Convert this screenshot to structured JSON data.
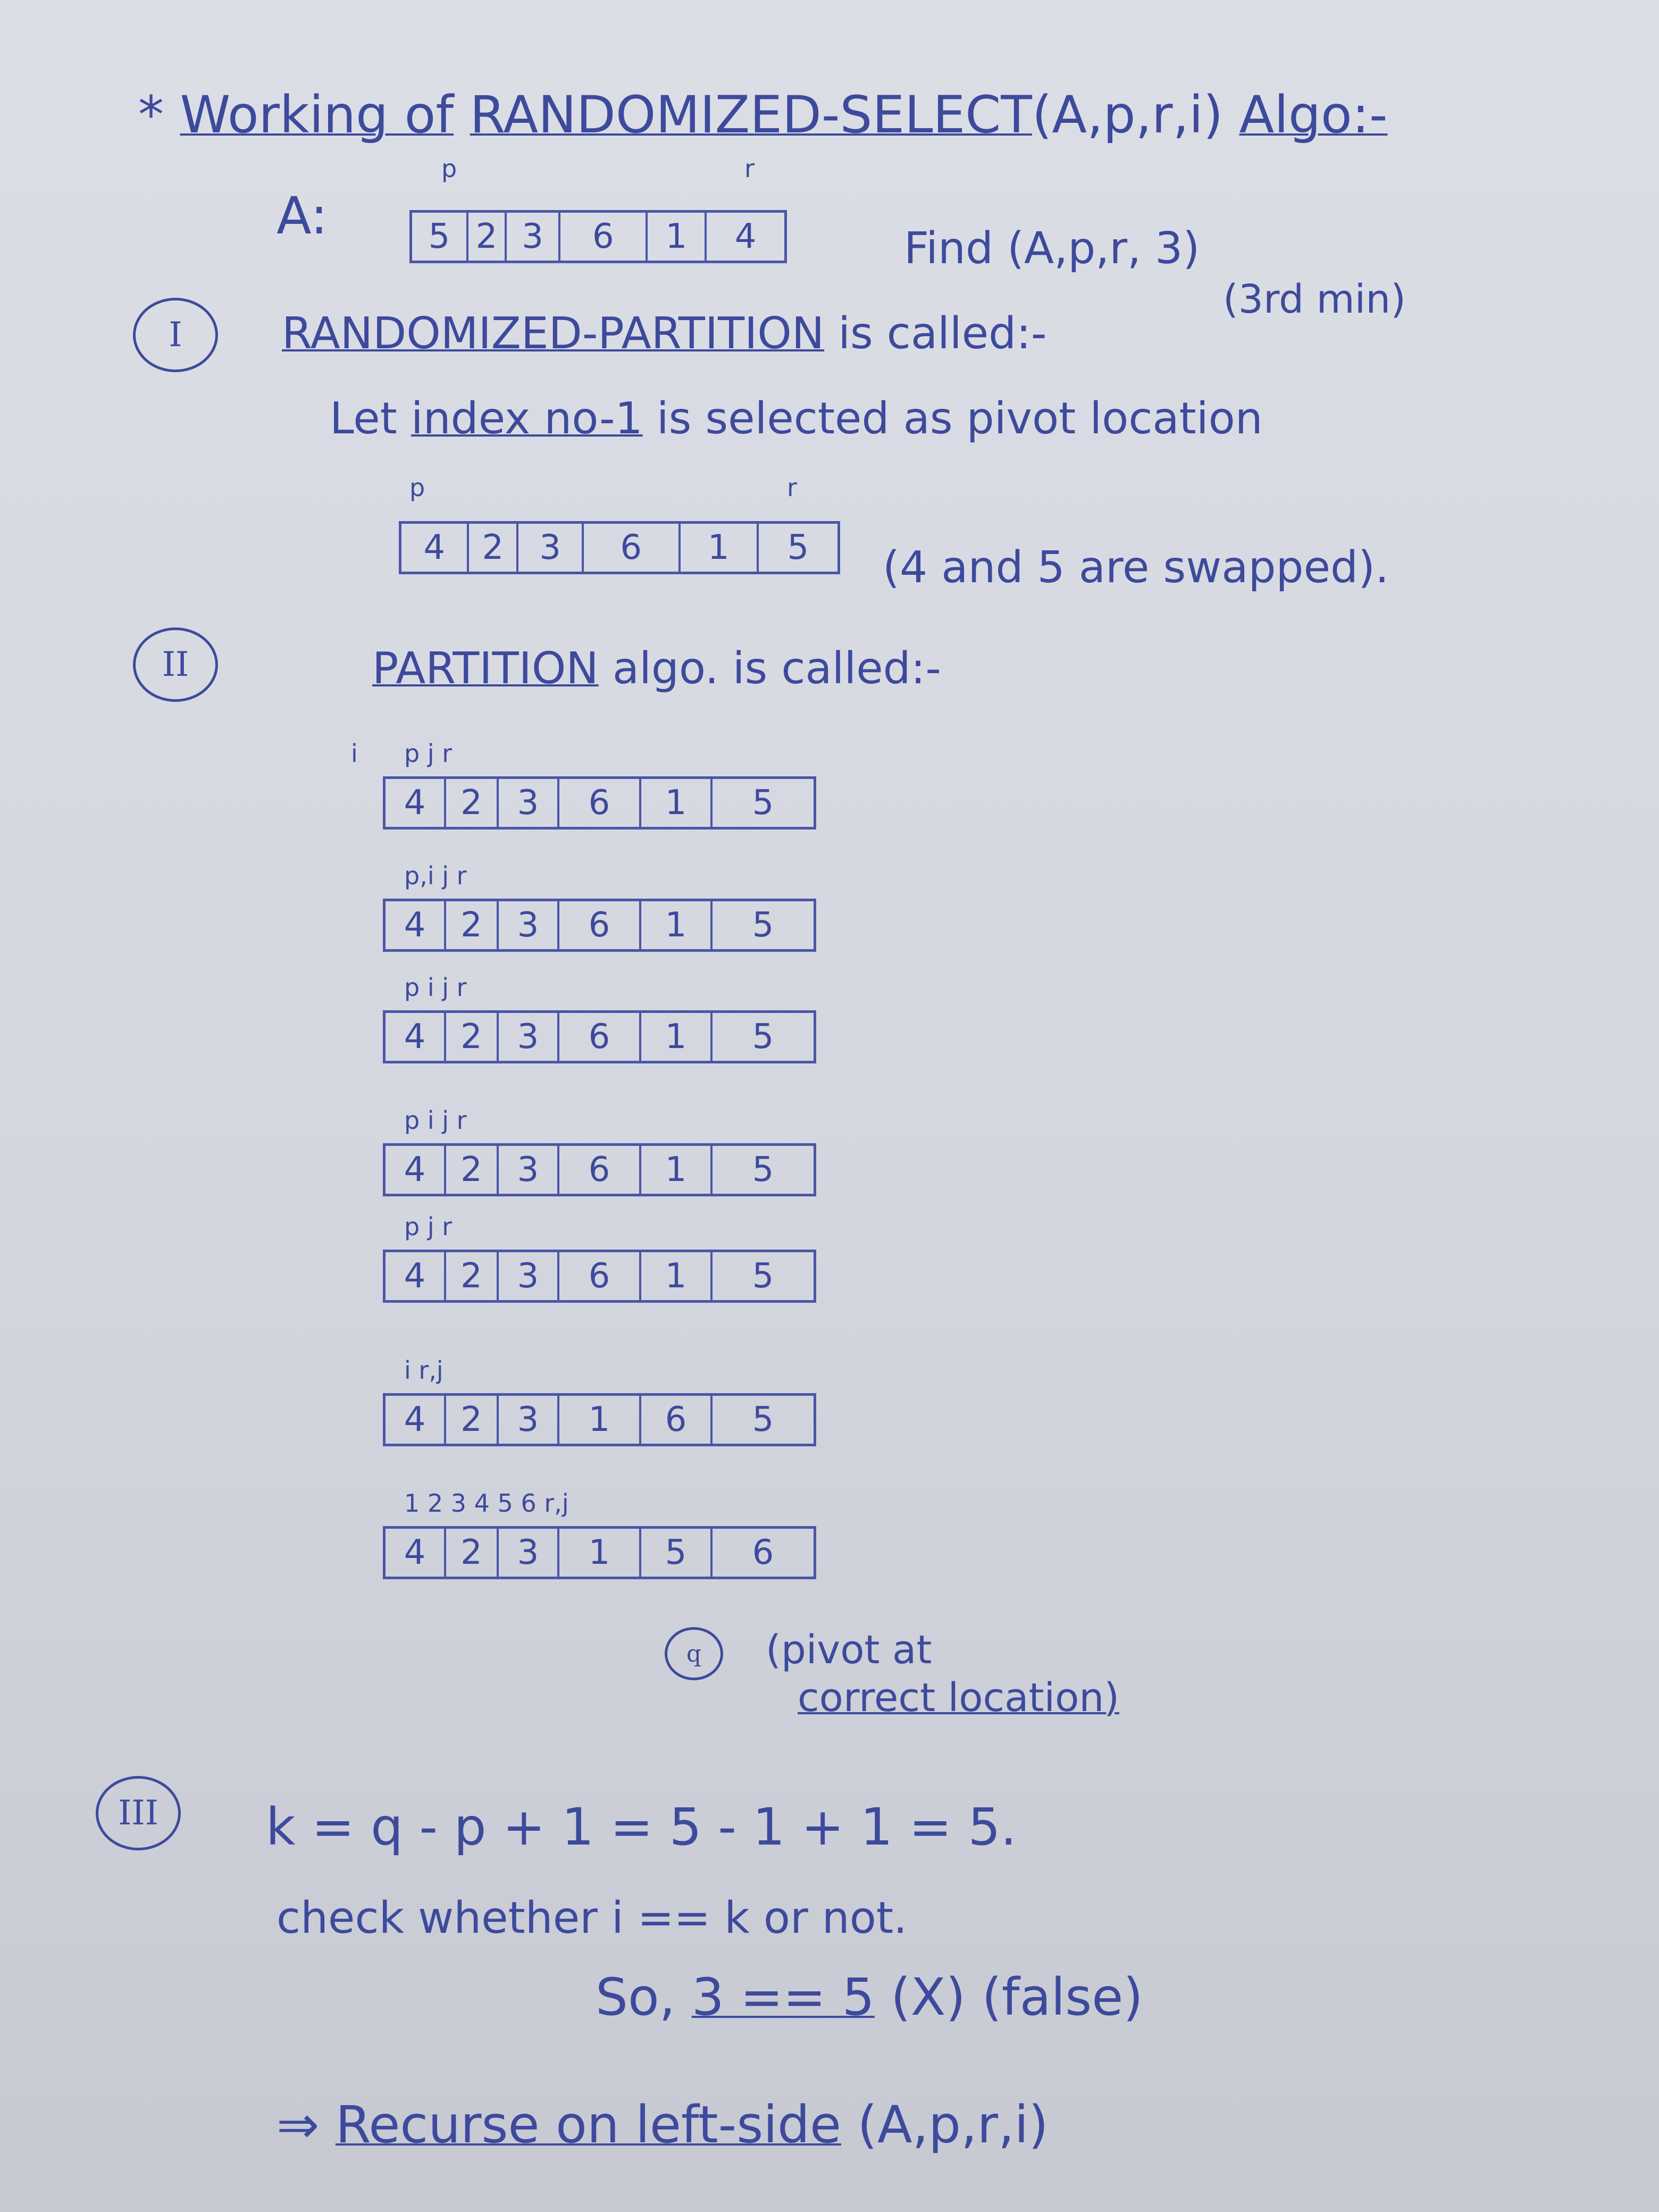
{
  "title": {
    "star": "*",
    "prefix": "Working of",
    "algorithm": "RANDOMIZED-SELECT",
    "args": "(A,p,r,i)",
    "suffix": "Algo:-"
  },
  "array_a": {
    "label": "A:",
    "p_label": "p",
    "r_label": "r",
    "cells": [
      "5",
      "2",
      "3",
      "6",
      "1",
      "4"
    ],
    "find_text": "Find (A,p,r, 3)",
    "note": "(3rd min)"
  },
  "steps": [
    {
      "marker": "I",
      "keyword": "RANDOMIZED-PARTITION",
      "rest": "is called:-",
      "line_a": "Let",
      "line_b": "index no-1",
      "line_c": "is selected as pivot location"
    },
    {
      "marker": "II",
      "keyword": "PARTITION",
      "rest": "algo. is called:-"
    },
    {
      "marker": "III"
    }
  ],
  "swapped": {
    "p_label": "p",
    "r_label": "r",
    "cells": [
      "4",
      "2",
      "3",
      "6",
      "1",
      "5"
    ],
    "note": "(4 and 5 are swapped)."
  },
  "trace_labels": {
    "i": "i"
  },
  "trace": [
    {
      "cells": [
        "4",
        "2",
        "3",
        "6",
        "1",
        "5"
      ],
      "label": "p j          r"
    },
    {
      "cells": [
        "4",
        "2",
        "3",
        "6",
        "1",
        "5"
      ],
      "label": "p,i  j          r"
    },
    {
      "cells": [
        "4",
        "2",
        "3",
        "6",
        "1",
        "5"
      ],
      "label": "p  i   j         r"
    },
    {
      "cells": [
        "4",
        "2",
        "3",
        "6",
        "1",
        "5"
      ],
      "label": "p    i   j        r"
    },
    {
      "cells": [
        "4",
        "2",
        "3",
        "6",
        "1",
        "5"
      ],
      "label": "p           j     r"
    },
    {
      "cells": [
        "4",
        "2",
        "3",
        "1",
        "6",
        "5"
      ],
      "label": "i        r,j"
    },
    {
      "cells": [
        "4",
        "2",
        "3",
        "1",
        "5",
        "6"
      ],
      "label": "1 2 3 4  5  6 r,j"
    }
  ],
  "pivot": {
    "marker": "q",
    "line1": "(pivot at",
    "line2": "correct location)"
  },
  "step3": {
    "formula": "k = q - p + 1 = 5 - 1 + 1 = 5.",
    "check": "check whether  i == k  or not.",
    "result_a": "So,",
    "result_b": "3 == 5",
    "result_c": "(X) (false)",
    "recurse_arrow": "⇒",
    "recurse_text": "Recurse on left-side",
    "recurse_args": "(A,p,r,i)"
  }
}
